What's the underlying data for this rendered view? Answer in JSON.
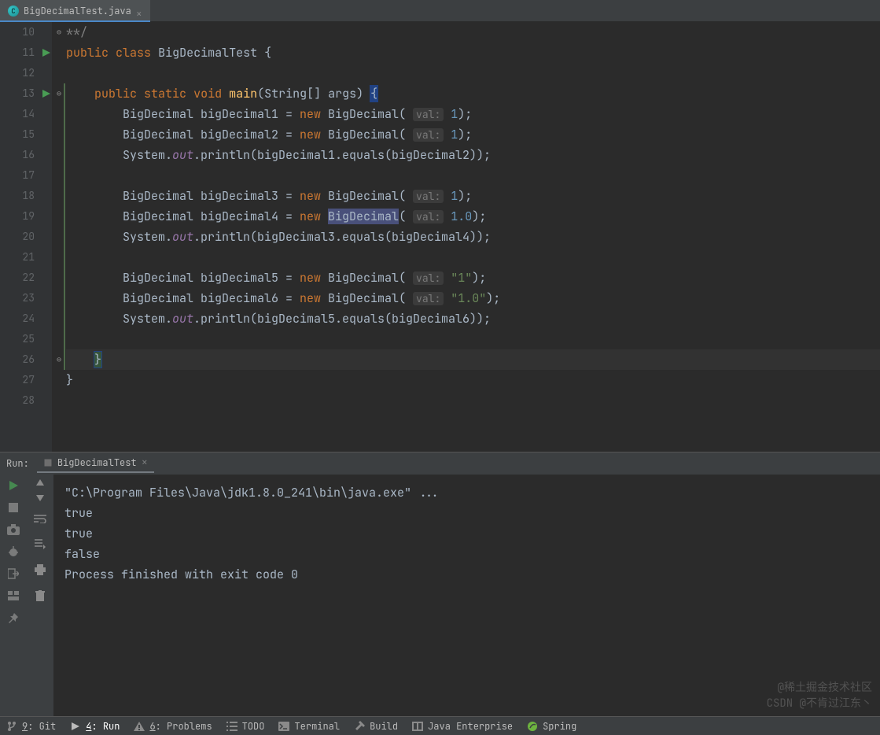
{
  "file_tab": {
    "name": "BigDecimalTest.java",
    "icon_letter": "C"
  },
  "editor": {
    "lines": [
      {
        "n": 10,
        "runnable": false,
        "html": "<span class='c'>**/</span>",
        "fold": "open"
      },
      {
        "n": 11,
        "runnable": true,
        "html": "<span class='k'>public</span> <span class='k'>class</span> <span class='t'>BigDecimalTest {</span>"
      },
      {
        "n": 12,
        "runnable": false,
        "html": ""
      },
      {
        "n": 13,
        "runnable": true,
        "html": "    <span class='k'>public</span> <span class='k'>static</span> <span class='k'>void</span> <span class='m'>main</span>(String[] args) <span class='caret-box'>{</span>",
        "fold": "open",
        "stripe": true
      },
      {
        "n": 14,
        "runnable": false,
        "html": "        BigDecimal bigDecimal1 = <span class='k'>new</span> BigDecimal( <span class='hint'>val:</span> <span class='n'>1</span>);",
        "stripe": true
      },
      {
        "n": 15,
        "runnable": false,
        "html": "        BigDecimal bigDecimal2 = <span class='k'>new</span> BigDecimal( <span class='hint'>val:</span> <span class='n'>1</span>);",
        "stripe": true
      },
      {
        "n": 16,
        "runnable": false,
        "html": "        System.<span class='i'>out</span>.println(bigDecimal1.equals(bigDecimal2));",
        "stripe": true
      },
      {
        "n": 17,
        "runnable": false,
        "html": "",
        "stripe": true
      },
      {
        "n": 18,
        "runnable": false,
        "html": "        BigDecimal bigDecimal3 = <span class='k'>new</span> BigDecimal( <span class='hint'>val:</span> <span class='n'>1</span>);",
        "stripe": true
      },
      {
        "n": 19,
        "runnable": false,
        "html": "        BigDecimal bigDecimal4 = <span class='k'>new</span> <span class='sel'>BigDecimal</span>( <span class='hint'>val:</span> <span class='n'>1.0</span>);",
        "stripe": true
      },
      {
        "n": 20,
        "runnable": false,
        "html": "        System.<span class='i'>out</span>.println(bigDecimal3.equals(bigDecimal4));",
        "stripe": true
      },
      {
        "n": 21,
        "runnable": false,
        "html": "",
        "stripe": true
      },
      {
        "n": 22,
        "runnable": false,
        "html": "        BigDecimal bigDecimal5 = <span class='k'>new</span> BigDecimal( <span class='hint'>val:</span> <span class='s'>\"1\"</span>);",
        "stripe": true
      },
      {
        "n": 23,
        "runnable": false,
        "html": "        BigDecimal bigDecimal6 = <span class='k'>new</span> BigDecimal( <span class='hint'>val:</span> <span class='s'>\"1.0\"</span>);",
        "stripe": true
      },
      {
        "n": 24,
        "runnable": false,
        "html": "        System.<span class='i'>out</span>.println(bigDecimal5.equals(bigDecimal6));",
        "stripe": true
      },
      {
        "n": 25,
        "runnable": false,
        "html": "",
        "stripe": true
      },
      {
        "n": 26,
        "runnable": false,
        "html": "    <span class='caret-box' style='background:#36543a'>}</span>",
        "fold": "close",
        "hl": true,
        "stripe": true
      },
      {
        "n": 27,
        "runnable": false,
        "html": "}"
      },
      {
        "n": 28,
        "runnable": false,
        "html": ""
      }
    ]
  },
  "run": {
    "header_label": "Run:",
    "config_name": "BigDecimalTest",
    "output": [
      "\"C:\\Program Files\\Java\\jdk1.8.0_241\\bin\\java.exe\" ...",
      "true",
      "true",
      "false",
      "",
      "Process finished with exit code 0"
    ],
    "toolbar1": [
      {
        "name": "rerun-button",
        "icon": "play-green"
      },
      {
        "name": "stop-button",
        "icon": "stop-gray"
      },
      {
        "name": "dump-button",
        "icon": "camera"
      },
      {
        "name": "debug-button",
        "icon": "bug"
      },
      {
        "name": "exit-button",
        "icon": "exit"
      },
      {
        "name": "layout-button",
        "icon": "layout"
      },
      {
        "name": "pin-button",
        "icon": "pin"
      }
    ],
    "toolbar2": [
      {
        "name": "up-button",
        "icon": "arrow-up"
      },
      {
        "name": "down-button",
        "icon": "arrow-down"
      },
      {
        "name": "wrap-button",
        "icon": "wrap"
      },
      {
        "name": "scroll-button",
        "icon": "scroll"
      },
      {
        "name": "print-button",
        "icon": "print"
      },
      {
        "name": "clear-button",
        "icon": "trash"
      }
    ]
  },
  "status_bar": {
    "items": [
      {
        "name": "git-tab",
        "icon": "branch",
        "key": "9",
        "label": ": Git"
      },
      {
        "name": "run-tab",
        "icon": "play",
        "key": "4",
        "label": ": Run",
        "active": true
      },
      {
        "name": "problems-tab",
        "icon": "warning",
        "key": "6",
        "label": ": Problems"
      },
      {
        "name": "todo-tab",
        "icon": "list",
        "key": "",
        "label": "TODO"
      },
      {
        "name": "terminal-tab",
        "icon": "terminal",
        "key": "",
        "label": "Terminal"
      },
      {
        "name": "build-tab",
        "icon": "hammer",
        "key": "",
        "label": "Build"
      },
      {
        "name": "java-enterprise-tab",
        "icon": "jee",
        "key": "",
        "label": "Java Enterprise"
      },
      {
        "name": "spring-tab",
        "icon": "spring",
        "key": "",
        "label": "Spring"
      }
    ]
  },
  "watermark": {
    "line1": "@稀土掘金技术社区",
    "line2": "CSDN @不肯过江东丶"
  }
}
